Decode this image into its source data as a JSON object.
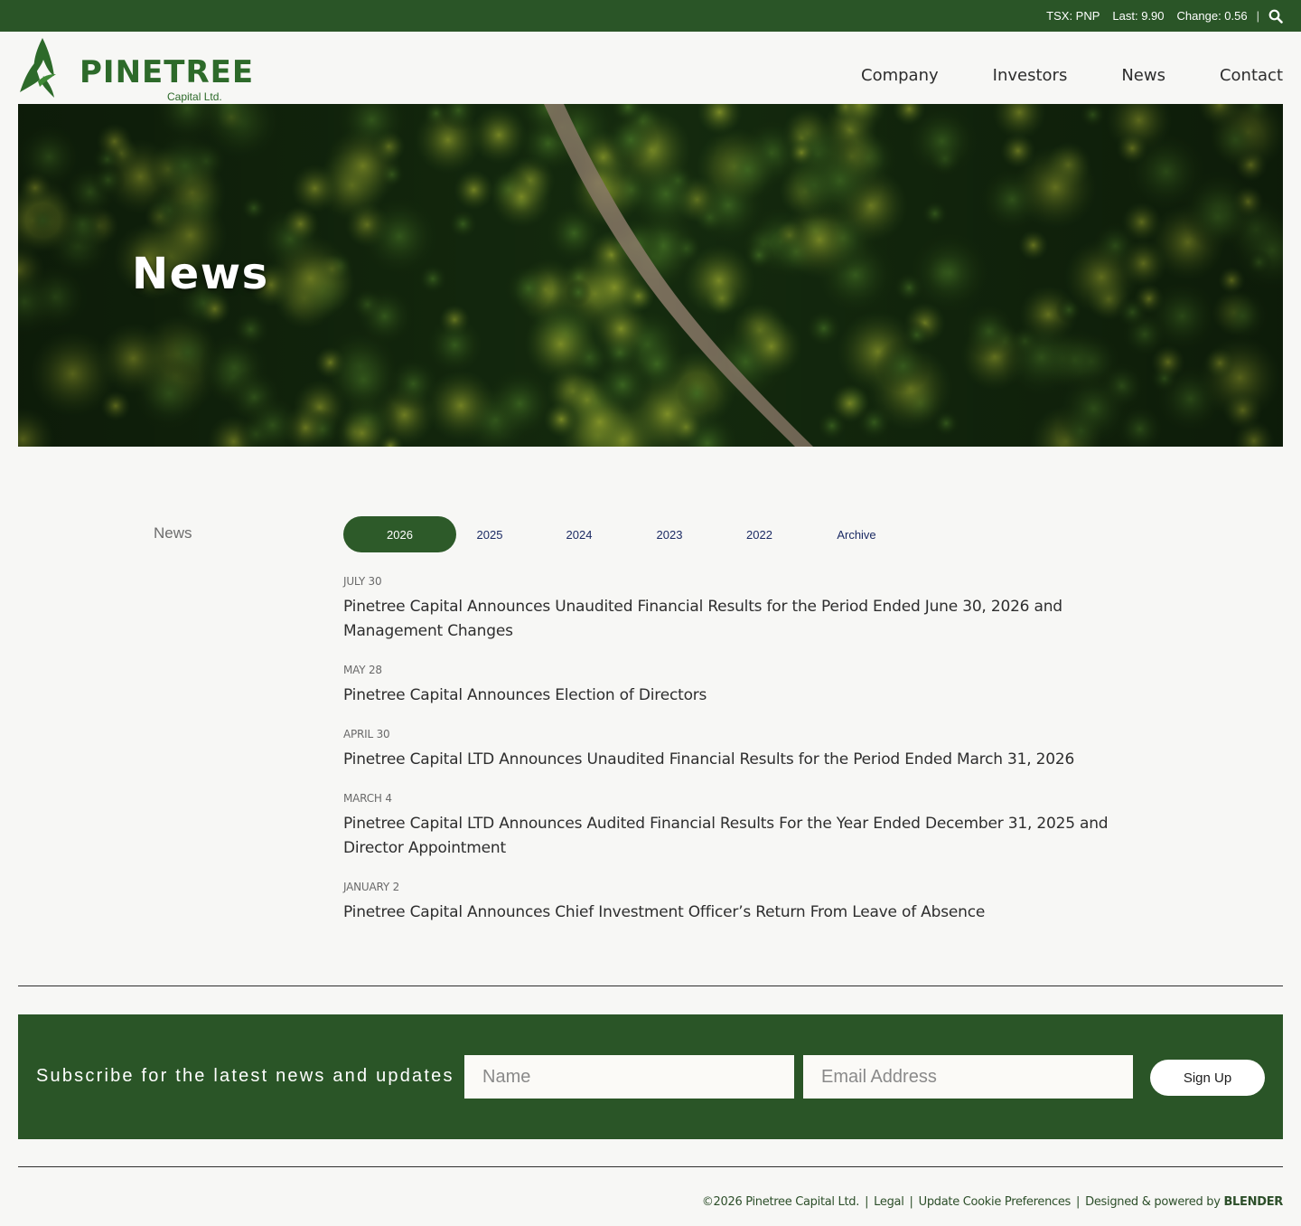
{
  "ticker": {
    "symbol": "TSX: PNP",
    "last": "Last: 9.90",
    "change": "Change: 0.56",
    "separator": "|",
    "search_icon": "search-icon"
  },
  "header": {
    "logo_word": "PINETREE",
    "logo_sub": "Capital Ltd.",
    "nav": [
      "Company",
      "Investors",
      "News",
      "Contact"
    ]
  },
  "hero": {
    "title": "News"
  },
  "news": {
    "side_label": "News",
    "tabs": [
      {
        "label": "2026",
        "active": true
      },
      {
        "label": "2025",
        "active": false
      },
      {
        "label": "2024",
        "active": false
      },
      {
        "label": "2023",
        "active": false
      },
      {
        "label": "2022",
        "active": false
      },
      {
        "label": "Archive",
        "active": false
      }
    ],
    "items": [
      {
        "date": "JULY 30",
        "title": "Pinetree Capital Announces Unaudited Financial Results for the Period Ended June 30, 2026 and Management Changes"
      },
      {
        "date": "MAY 28",
        "title": "Pinetree Capital Announces Election of Directors"
      },
      {
        "date": "APRIL 30",
        "title": "Pinetree Capital LTD Announces Unaudited Financial Results for the Period Ended March 31, 2026"
      },
      {
        "date": "MARCH 4",
        "title": "Pinetree Capital LTD Announces Audited Financial Results For the Year Ended December 31, 2025 and Director Appointment"
      },
      {
        "date": "JANUARY 2",
        "title": "Pinetree Capital Announces Chief Investment Officer’s Return From Leave of Absence"
      }
    ]
  },
  "subscribe": {
    "text": "Subscribe for the latest news and updates",
    "name_placeholder": "Name",
    "email_placeholder": "Email Address",
    "button": "Sign Up"
  },
  "footer": {
    "copyright": "©2026 Pinetree Capital Ltd.",
    "legal": "Legal",
    "cookies": "Update Cookie Preferences",
    "designed_by": "Designed & powered by",
    "brand": "BLENDER",
    "separator": "|"
  },
  "colors": {
    "brand_green": "#2a5527",
    "link_blue": "#1c2b64"
  }
}
